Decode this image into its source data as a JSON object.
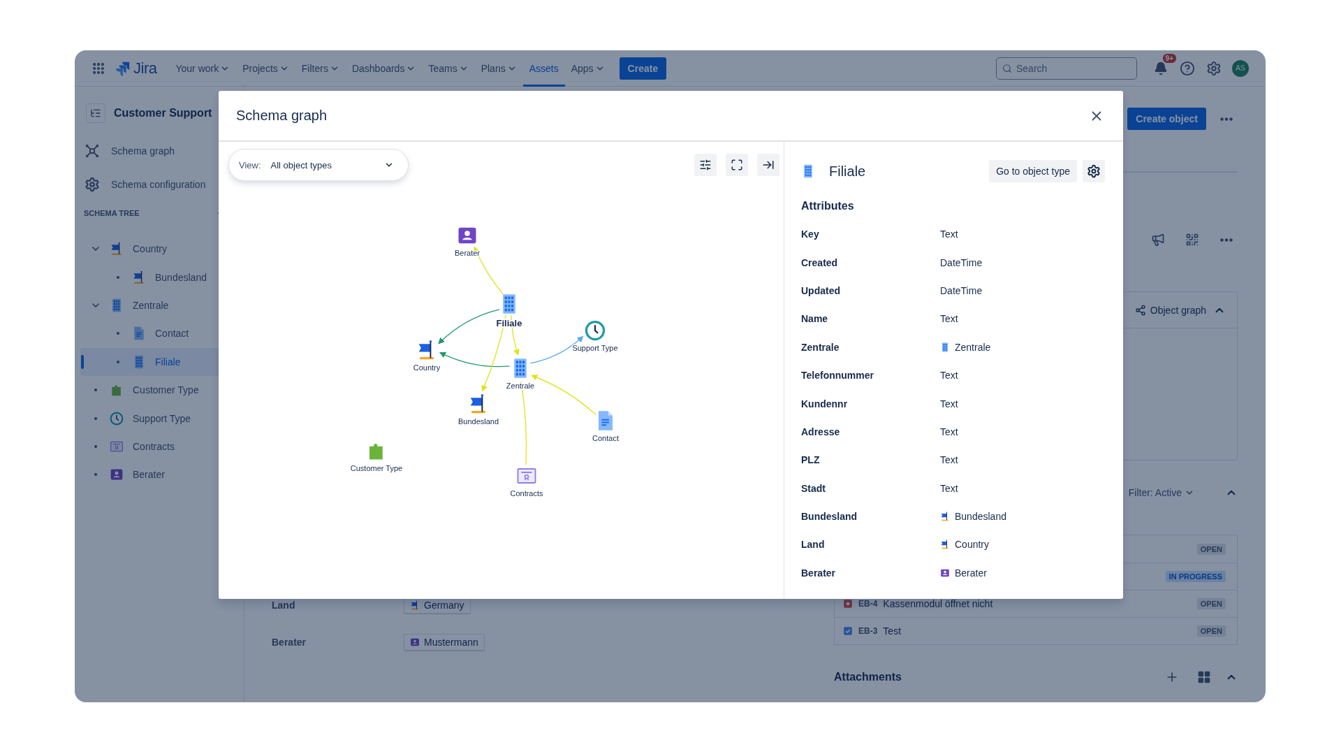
{
  "top_nav": {
    "product": "Jira",
    "items": [
      {
        "label": "Your work",
        "dropdown": true,
        "selected": false
      },
      {
        "label": "Projects",
        "dropdown": true,
        "selected": false
      },
      {
        "label": "Filters",
        "dropdown": true,
        "selected": false
      },
      {
        "label": "Dashboards",
        "dropdown": true,
        "selected": false
      },
      {
        "label": "Teams",
        "dropdown": true,
        "selected": false
      },
      {
        "label": "Plans",
        "dropdown": true,
        "selected": false
      },
      {
        "label": "Assets",
        "dropdown": false,
        "selected": true
      },
      {
        "label": "Apps",
        "dropdown": true,
        "selected": false
      }
    ],
    "create_button": "Create",
    "search": {
      "placeholder": "Search"
    },
    "notification_badge": "9+",
    "avatar_initials": "AS"
  },
  "sidebar": {
    "title": "Customer Support",
    "links": [
      {
        "label": "Schema graph",
        "kind": "graph"
      },
      {
        "label": "Schema configuration",
        "kind": "gear"
      }
    ],
    "tree_heading": "SCHEMA TREE",
    "tree": [
      {
        "label": "Country",
        "kind": "flag",
        "selected": false,
        "expanded": true,
        "children": [
          {
            "label": "Bundesland",
            "kind": "flag",
            "selected": false
          }
        ]
      },
      {
        "label": "Zentrale",
        "kind": "building",
        "selected": false,
        "expanded": true,
        "children": [
          {
            "label": "Contact",
            "kind": "document",
            "selected": false
          },
          {
            "label": "Filiale",
            "kind": "building",
            "selected": true
          }
        ]
      },
      {
        "label": "Customer Type",
        "kind": "puzzle",
        "selected": false
      },
      {
        "label": "Support Type",
        "kind": "clock",
        "selected": false
      },
      {
        "label": "Contracts",
        "kind": "certificate",
        "selected": false
      },
      {
        "label": "Berater",
        "kind": "person",
        "selected": false
      }
    ]
  },
  "page": {
    "create_object_button": "Create object",
    "object_graph": {
      "title": "Object graph",
      "expanded": true
    },
    "filter_button": "Filter: Active",
    "issues_expanded": true,
    "issues": [
      {
        "status": {
          "text": "OPEN",
          "kind": "neutral"
        }
      },
      {
        "status": {
          "text": "IN PROGRESS",
          "kind": "progress"
        }
      },
      {
        "kind": "bug",
        "key": "EB-4",
        "summary": "Kassenmodul öffnet nicht",
        "status": {
          "text": "OPEN",
          "kind": "neutral"
        }
      },
      {
        "kind": "task",
        "key": "EB-3",
        "summary": "Test",
        "status": {
          "text": "OPEN",
          "kind": "neutral"
        }
      }
    ],
    "attributes": [
      {
        "label": "Land",
        "value": "Germany",
        "kind": "flag"
      },
      {
        "label": "Berater",
        "value": "Mustermann",
        "kind": "person"
      }
    ],
    "attachments": {
      "title": "Attachments",
      "expanded": true
    }
  },
  "modal": {
    "title": "Schema graph",
    "view": {
      "label": "View:",
      "value": "All object types"
    },
    "nodes": [
      {
        "label": "Berater",
        "kind": "person",
        "selected": false
      },
      {
        "label": "Filiale",
        "kind": "building",
        "selected": true
      },
      {
        "label": "Country",
        "kind": "flag",
        "selected": false
      },
      {
        "label": "Zentrale",
        "kind": "building",
        "selected": false
      },
      {
        "label": "Support Type",
        "kind": "clock",
        "selected": false
      },
      {
        "label": "Bundesland",
        "kind": "flag",
        "selected": false
      },
      {
        "label": "Contact",
        "kind": "document",
        "selected": false
      },
      {
        "label": "Customer Type",
        "kind": "puzzle",
        "selected": false
      },
      {
        "label": "Contracts",
        "kind": "certificate",
        "selected": false
      }
    ],
    "details": {
      "title": "Filiale",
      "kind": "building",
      "go_button": "Go to object type",
      "attributes_heading": "Attributes",
      "attributes": [
        {
          "name": "Key",
          "type": "Text",
          "kind": "plain"
        },
        {
          "name": "Created",
          "type": "DateTime",
          "kind": "plain"
        },
        {
          "name": "Updated",
          "type": "DateTime",
          "kind": "plain"
        },
        {
          "name": "Name",
          "type": "Text",
          "kind": "plain"
        },
        {
          "name": "Zentrale",
          "type": "Zentrale",
          "kind": "building"
        },
        {
          "name": "Telefonnummer",
          "type": "Text",
          "kind": "plain"
        },
        {
          "name": "Kundennr",
          "type": "Text",
          "kind": "plain"
        },
        {
          "name": "Adresse",
          "type": "Text",
          "kind": "plain"
        },
        {
          "name": "PLZ",
          "type": "Text",
          "kind": "plain"
        },
        {
          "name": "Stadt",
          "type": "Text",
          "kind": "plain"
        },
        {
          "name": "Bundesland",
          "type": "Bundesland",
          "kind": "flag"
        },
        {
          "name": "Land",
          "type": "Country",
          "kind": "flag"
        },
        {
          "name": "Berater",
          "type": "Berater",
          "kind": "person"
        }
      ]
    }
  }
}
